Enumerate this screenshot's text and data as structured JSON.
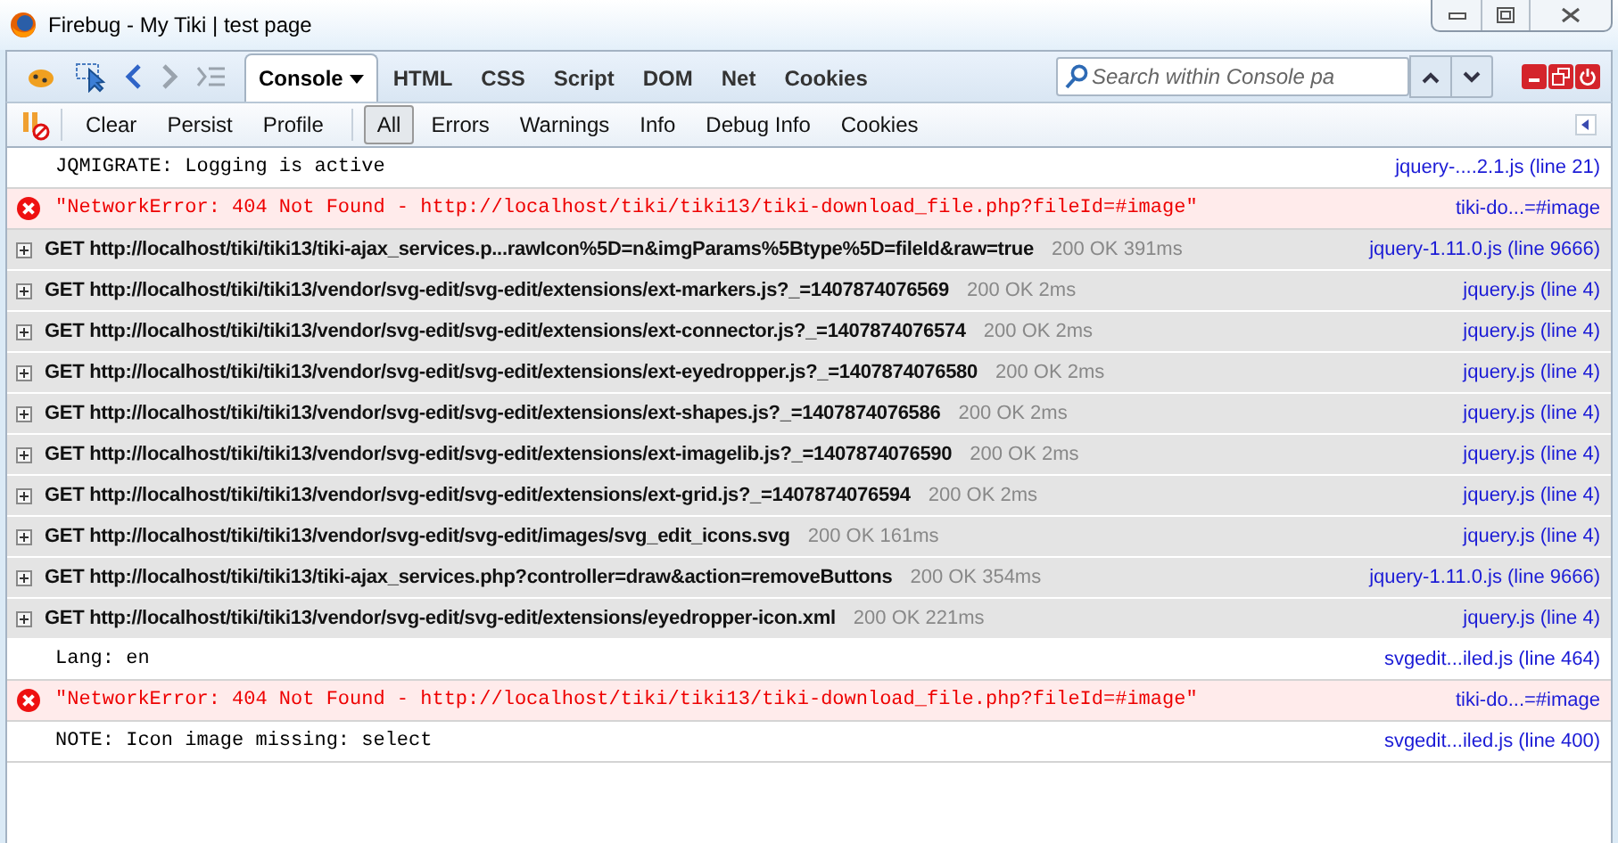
{
  "window": {
    "title": "Firebug - My Tiki | test page"
  },
  "tabs": [
    {
      "label": "Console",
      "selected": true,
      "dropdown": true
    },
    {
      "label": "HTML",
      "selected": false
    },
    {
      "label": "CSS",
      "selected": false
    },
    {
      "label": "Script",
      "selected": false
    },
    {
      "label": "DOM",
      "selected": false
    },
    {
      "label": "Net",
      "selected": false
    },
    {
      "label": "Cookies",
      "selected": false
    }
  ],
  "search": {
    "placeholder": "Search within Console pa"
  },
  "console_actions": [
    "Clear",
    "Persist",
    "Profile"
  ],
  "filters": [
    {
      "label": "All",
      "selected": true
    },
    {
      "label": "Errors",
      "selected": false
    },
    {
      "label": "Warnings",
      "selected": false
    },
    {
      "label": "Info",
      "selected": false
    },
    {
      "label": "Debug Info",
      "selected": false
    },
    {
      "label": "Cookies",
      "selected": false
    }
  ],
  "messages": [
    {
      "kind": "log",
      "text": "JQMIGRATE: Logging is active",
      "source": "jquery-....2.1.js (line 21)"
    },
    {
      "kind": "error",
      "text": "\"NetworkError: 404 Not Found - http://localhost/tiki/tiki13/tiki-download_file.php?fileId=#image\"",
      "source": "tiki-do...=#image"
    },
    {
      "kind": "request",
      "text": "GET http://localhost/tiki/tiki13/tiki-ajax_services.p...rawIcon%5D=n&imgParams%5Btype%5D=fileId&raw=true",
      "status": "200 OK 391ms",
      "source": "jquery-1.11.0.js (line 9666)"
    },
    {
      "kind": "request",
      "text": "GET http://localhost/tiki/tiki13/vendor/svg-edit/svg-edit/extensions/ext-markers.js?_=1407874076569",
      "status": "200 OK 2ms",
      "source": "jquery.js (line 4)"
    },
    {
      "kind": "request",
      "text": "GET http://localhost/tiki/tiki13/vendor/svg-edit/svg-edit/extensions/ext-connector.js?_=1407874076574",
      "status": "200 OK 2ms",
      "source": "jquery.js (line 4)"
    },
    {
      "kind": "request",
      "text": "GET http://localhost/tiki/tiki13/vendor/svg-edit/svg-edit/extensions/ext-eyedropper.js?_=1407874076580",
      "status": "200 OK 2ms",
      "source": "jquery.js (line 4)"
    },
    {
      "kind": "request",
      "text": "GET http://localhost/tiki/tiki13/vendor/svg-edit/svg-edit/extensions/ext-shapes.js?_=1407874076586",
      "status": "200 OK 2ms",
      "source": "jquery.js (line 4)"
    },
    {
      "kind": "request",
      "text": "GET http://localhost/tiki/tiki13/vendor/svg-edit/svg-edit/extensions/ext-imagelib.js?_=1407874076590",
      "status": "200 OK 2ms",
      "source": "jquery.js (line 4)"
    },
    {
      "kind": "request",
      "text": "GET http://localhost/tiki/tiki13/vendor/svg-edit/svg-edit/extensions/ext-grid.js?_=1407874076594",
      "status": "200 OK 2ms",
      "source": "jquery.js (line 4)"
    },
    {
      "kind": "request",
      "text": "GET http://localhost/tiki/tiki13/vendor/svg-edit/svg-edit/images/svg_edit_icons.svg",
      "status": "200 OK 161ms",
      "source": "jquery.js (line 4)"
    },
    {
      "kind": "request",
      "text": "GET http://localhost/tiki/tiki13/tiki-ajax_services.php?controller=draw&action=removeButtons",
      "status": "200 OK 354ms",
      "source": "jquery-1.11.0.js (line 9666)"
    },
    {
      "kind": "request",
      "text": "GET http://localhost/tiki/tiki13/vendor/svg-edit/svg-edit/extensions/eyedropper-icon.xml",
      "status": "200 OK 221ms",
      "source": "jquery.js (line 4)"
    },
    {
      "kind": "log",
      "text": "Lang: en",
      "source": "svgedit...iled.js (line 464)"
    },
    {
      "kind": "error",
      "text": "\"NetworkError: 404 Not Found - http://localhost/tiki/tiki13/tiki-download_file.php?fileId=#image\"",
      "source": "tiki-do...=#image"
    },
    {
      "kind": "log",
      "text": "NOTE: Icon image missing: select",
      "source": "svgedit...iled.js (line 400)"
    }
  ]
}
